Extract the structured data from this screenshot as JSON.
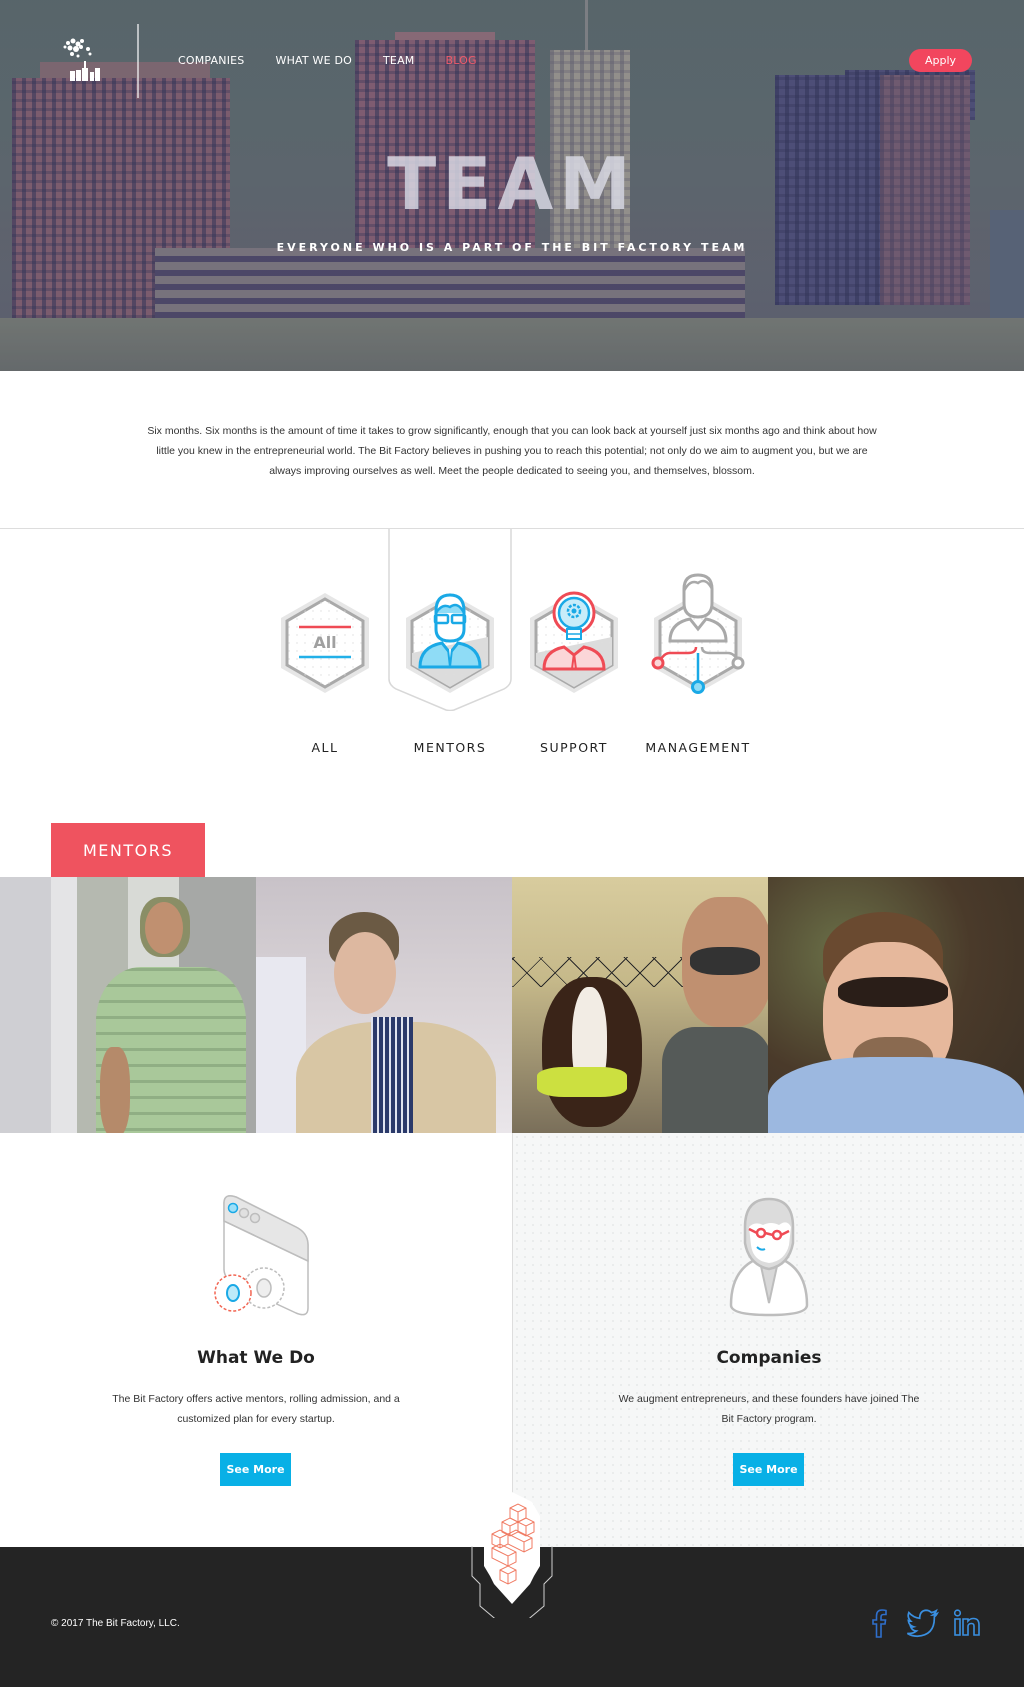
{
  "nav": {
    "logo": "The Bit Factory logo",
    "links": [
      {
        "label": "COMPANIES",
        "active": false
      },
      {
        "label": "WHAT WE DO",
        "active": false
      },
      {
        "label": "TEAM",
        "active": false
      },
      {
        "label": "BLOG",
        "active": true
      }
    ],
    "apply_label": "Apply"
  },
  "hero": {
    "title": "TEAM",
    "subtitle": "EVERYONE WHO IS A PART OF THE BIT FACTORY TEAM"
  },
  "intro": {
    "text": "Six months. Six months is the amount of time it takes to grow significantly, enough that you can look back at yourself just six months ago and think about how little you knew in the entrepreneurial world. The Bit Factory believes in pushing you to reach this potential; not only do we aim to augment you, but we are always improving ourselves as well. Meet the people dedicated to seeing you, and themselves, blossom."
  },
  "categories": {
    "selected": "MENTORS",
    "items": [
      {
        "label": "ALL",
        "icon": "all-icon",
        "icon_text": "All"
      },
      {
        "label": "MENTORS",
        "icon": "mentor-icon"
      },
      {
        "label": "SUPPORT",
        "icon": "support-lightbulb-icon"
      },
      {
        "label": "MANAGEMENT",
        "icon": "management-network-icon"
      }
    ]
  },
  "section": {
    "badge": "MENTORS"
  },
  "mentors": [
    {
      "photo": "mentor-photo-1",
      "alt": "Man in striped green polo"
    },
    {
      "photo": "mentor-photo-2",
      "alt": "Man in tan blazer smiling"
    },
    {
      "photo": "mentor-photo-3",
      "alt": "Man in sunglasses holding a puppy"
    },
    {
      "photo": "mentor-photo-4",
      "alt": "Man in sunglasses and blue shirt"
    }
  ],
  "cards": [
    {
      "title": "What We Do",
      "desc": "The Bit Factory offers active mentors, rolling admission, and a customized plan for every startup.",
      "button": "See More",
      "icon": "browser-gears-icon"
    },
    {
      "title": "Companies",
      "desc": "We augment entrepreneurs, and these founders have joined The Bit Factory program.",
      "button": "See More",
      "icon": "founder-avatar-icon"
    }
  ],
  "footer": {
    "copyright": "© 2017 The Bit Factory, LLC.",
    "social": [
      "facebook",
      "twitter",
      "linkedin"
    ]
  },
  "colors": {
    "accent_red": "#ef535f",
    "apply_pink": "#f2465e",
    "button_blue": "#08b0e6",
    "social_blue": "#3a8fe0",
    "footer_bg": "#242424"
  }
}
